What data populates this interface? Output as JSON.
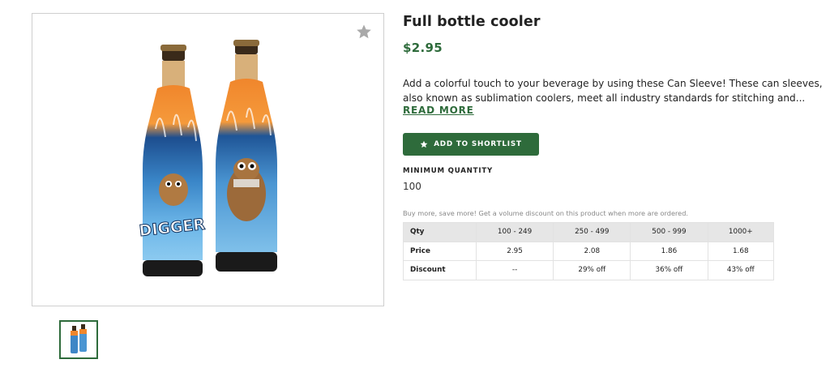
{
  "product": {
    "title": "Full bottle cooler",
    "price": "$2.95",
    "description_lines": [
      "Add a colorful touch to your beverage by using these Can Sleeve! These can sleeves,",
      "also known as sublimation coolers, meet all industry standards for stitching and..."
    ],
    "read_more": "READ MORE",
    "add_to_shortlist": "ADD TO SHORTLIST",
    "minimum_quantity_label": "MINIMUM QUANTITY",
    "minimum_quantity_value": "100",
    "volume_note": "Buy more, save more! Get a volume discount on this product when more are ordered."
  },
  "pricing_table": {
    "header": [
      "Qty",
      "100 - 249",
      "250 - 499",
      "500 - 999",
      "1000+"
    ],
    "rows": [
      [
        "Price",
        "2.95",
        "2.08",
        "1.86",
        "1.68"
      ],
      [
        "Discount",
        "--",
        "29% off",
        "36% off",
        "43% off"
      ]
    ]
  },
  "image_label": "DIGGER",
  "icons": {
    "favorite": "star-icon",
    "shortlist": "star-icon"
  },
  "colors": {
    "accent": "#2e6b3b",
    "table_header_bg": "#e6e6e6"
  }
}
